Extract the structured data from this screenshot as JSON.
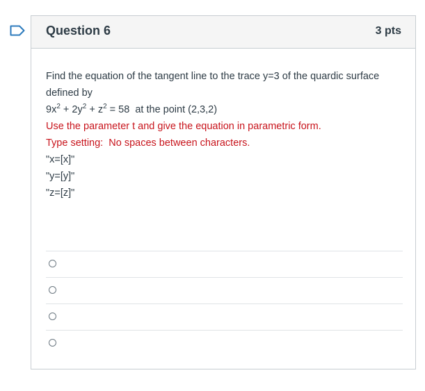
{
  "question": {
    "title": "Question 6",
    "points": "3 pts",
    "prompt_line1": "Find the equation of the tangent line to the trace y=3 of the quardic surface defined by",
    "equation": {
      "t1": "9x",
      "e1": "2",
      "t2": " + 2y",
      "e2": "2",
      "t3": " + z",
      "e3": "2",
      "t4": " = 58  at the point (2,3,2)"
    },
    "instruction1": "Use the parameter t and give the equation in parametric form.",
    "instruction2": "Type setting:  No spaces between characters.",
    "format_x": "\"x=[x]\"",
    "format_y": "\"y=[y]\"",
    "format_z": "\"z=[z]\""
  },
  "answers": [
    {
      "label": ""
    },
    {
      "label": ""
    },
    {
      "label": ""
    },
    {
      "label": ""
    }
  ],
  "colors": {
    "instruction_red": "#c8141c",
    "text": "#2d3b45",
    "header_bg": "#f5f5f5",
    "border": "#c7cdd1",
    "flag_blue": "#2b7abc"
  }
}
